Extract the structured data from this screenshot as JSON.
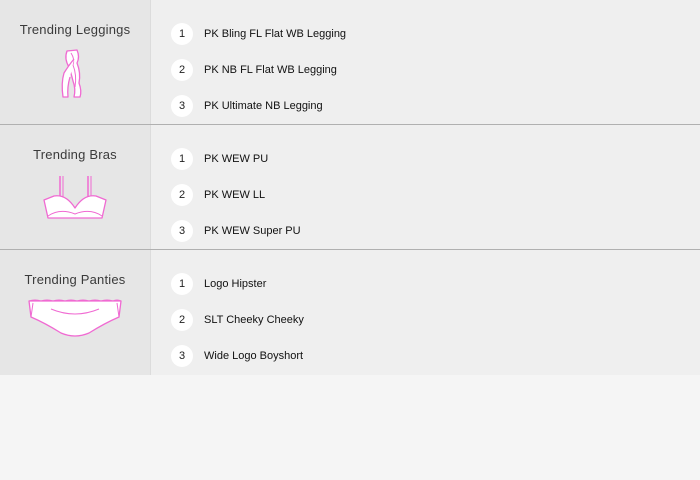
{
  "colors": {
    "accent_pink": "#f06ad2",
    "left_bg": "#e6e6e6",
    "right_bg": "#efefef",
    "divider": "#b0b0b0"
  },
  "categories": [
    {
      "title": "Trending Leggings",
      "icon": "leggings-icon",
      "items": [
        {
          "rank": "1",
          "label": "PK Bling FL Flat WB Legging"
        },
        {
          "rank": "2",
          "label": "PK NB FL Flat WB Legging"
        },
        {
          "rank": "3",
          "label": "PK Ultimate NB Legging"
        }
      ]
    },
    {
      "title": "Trending Bras",
      "icon": "bra-icon",
      "items": [
        {
          "rank": "1",
          "label": "PK WEW PU"
        },
        {
          "rank": "2",
          "label": "PK WEW LL"
        },
        {
          "rank": "3",
          "label": "PK WEW Super PU"
        }
      ]
    },
    {
      "title": "Trending Panties",
      "icon": "panty-icon",
      "items": [
        {
          "rank": "1",
          "label": "Logo Hipster"
        },
        {
          "rank": "2",
          "label": "SLT Cheeky Cheeky"
        },
        {
          "rank": "3",
          "label": "Wide Logo Boyshort"
        }
      ]
    }
  ]
}
